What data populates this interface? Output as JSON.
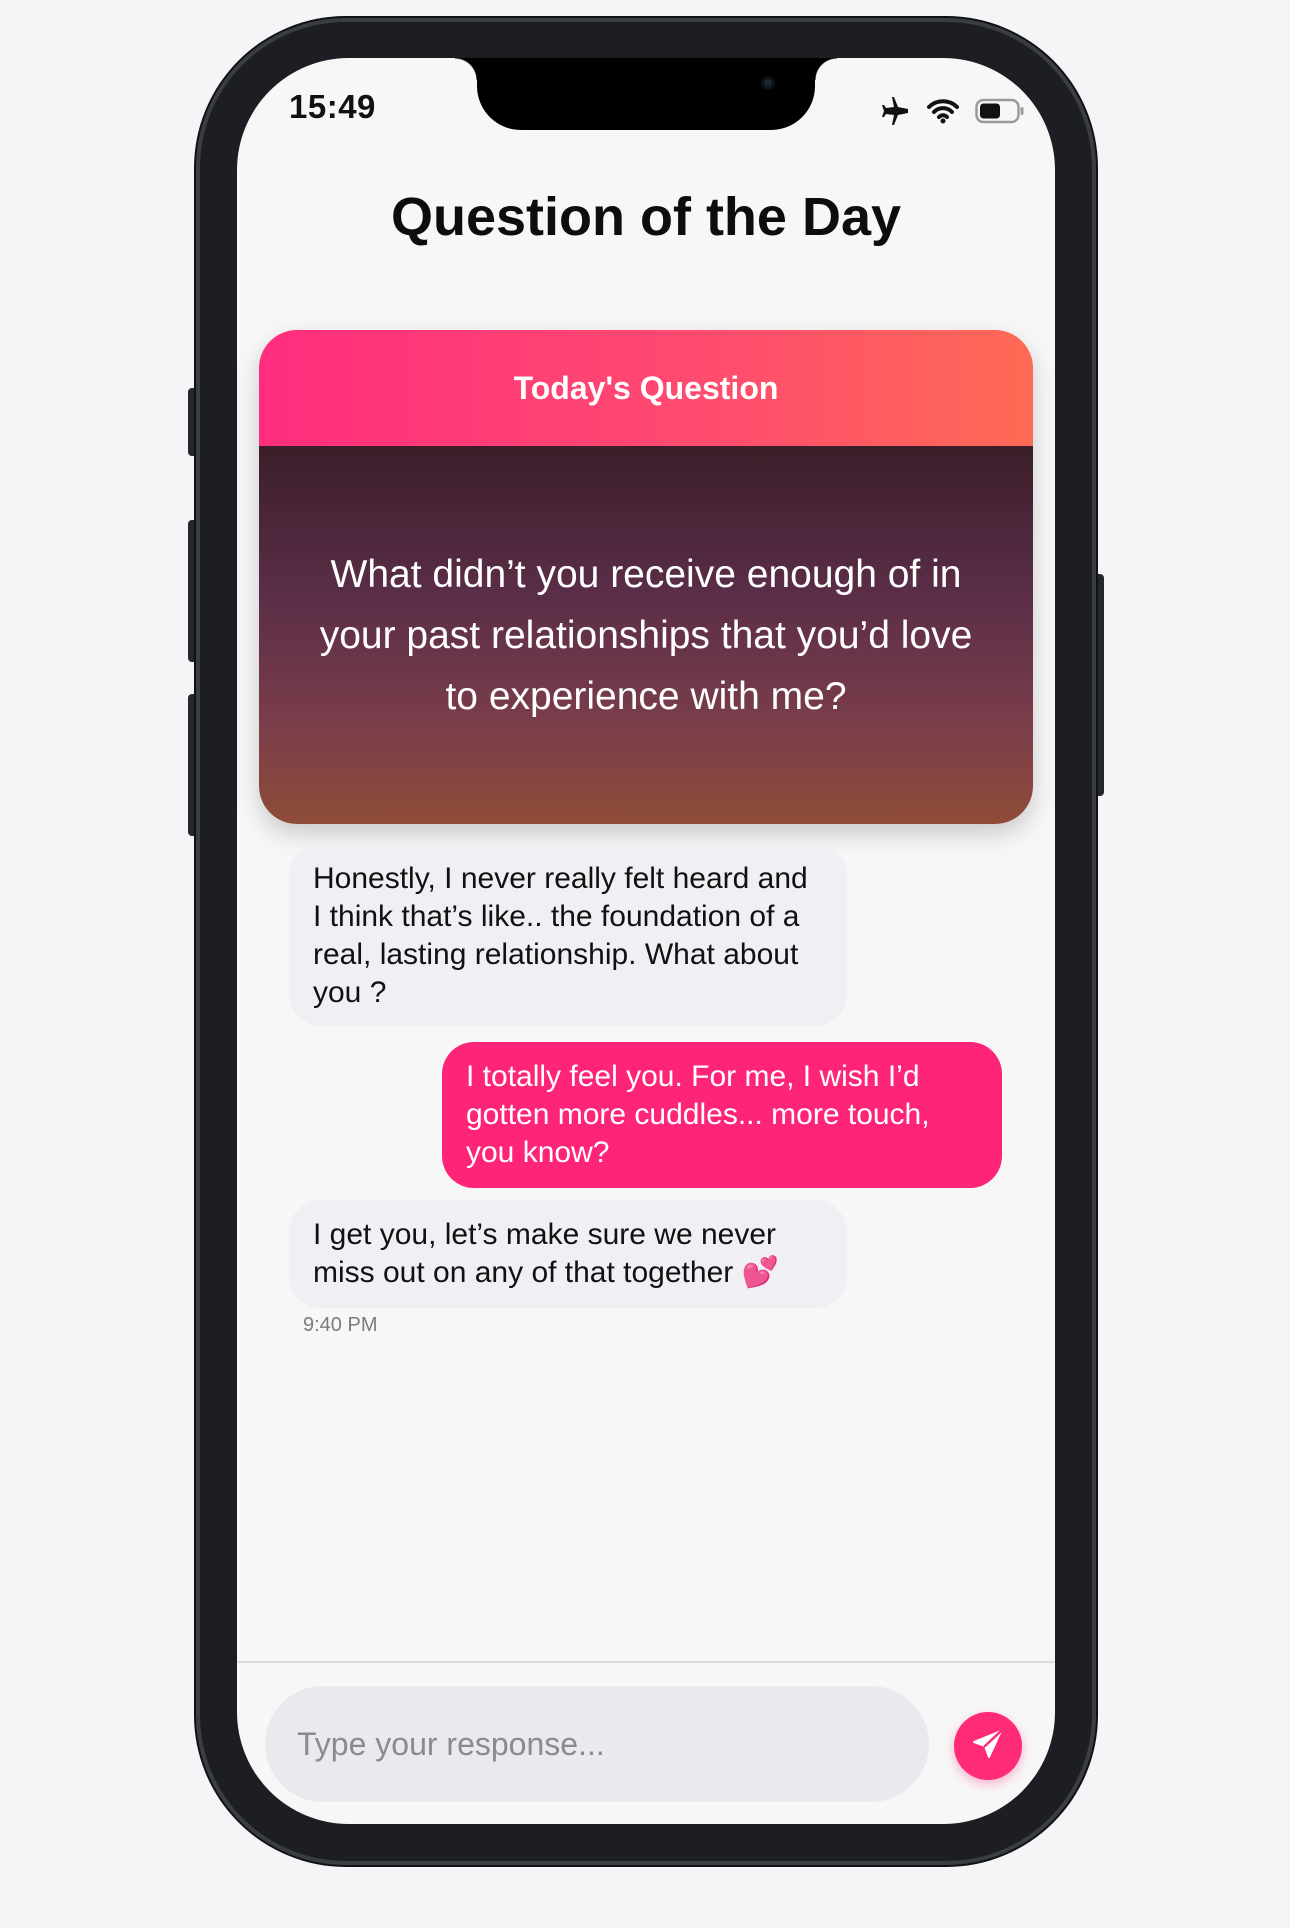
{
  "status_bar": {
    "time": "15:49",
    "icons": [
      "airplane-icon",
      "wifi-icon",
      "battery-icon"
    ]
  },
  "header": {
    "title": "Question of the Day"
  },
  "question_card": {
    "label": "Today's Question",
    "question": "What didn’t you receive enough of in your past relationships that you’d love to experience with me?"
  },
  "messages": [
    {
      "sender": "incoming",
      "text": "Honestly, I never really felt heard and I think that’s like.. the foundation of a real, lasting relationship. What about you ?"
    },
    {
      "sender": "outgoing",
      "text": "I totally feel you. For me, I wish I’d gotten more cuddles... more touch, you know?"
    },
    {
      "sender": "incoming",
      "text": "I get you, let’s make sure we never miss out on any of that together 💕"
    }
  ],
  "last_message_time": "9:40 PM",
  "composer": {
    "placeholder": "Type your response...",
    "value": "",
    "send_icon": "paper-plane-icon"
  },
  "colors": {
    "accent": "#ff2a78",
    "outgoing_bubble": "#fe2579",
    "incoming_bubble": "#efeff4",
    "header_gradient_start": "#ff2d7e",
    "header_gradient_end": "#ff6a55"
  }
}
